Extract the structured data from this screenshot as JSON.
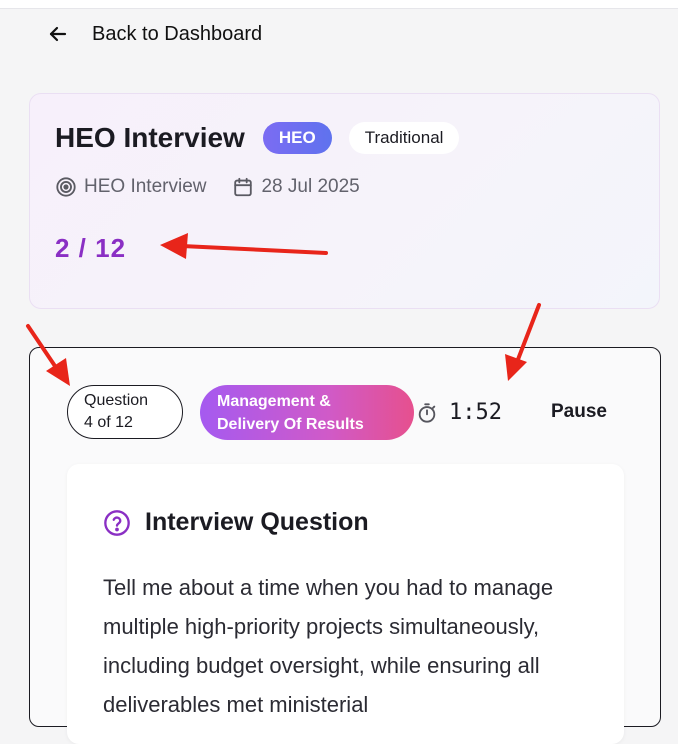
{
  "nav": {
    "back_label": "Back to Dashboard",
    "back_icon": "arrow-left-icon"
  },
  "interview": {
    "title": "HEO Interview",
    "badges": [
      "HEO",
      "Traditional"
    ],
    "meta": {
      "type_icon": "target-icon",
      "type_label": "HEO Interview",
      "date_icon": "calendar-icon",
      "date": "28 Jul 2025"
    },
    "progress_text": "2 / 12"
  },
  "question_panel": {
    "counter_line1": "Question",
    "counter_line2": "4 of 12",
    "category_line1": "Management &",
    "category_line2": "Delivery Of Results",
    "timer_icon": "stopwatch-icon",
    "timer": "1:52",
    "pause_label": "Pause",
    "heading_icon": "help-circle-icon",
    "heading": "Interview Question",
    "question_text": "Tell me about a time when you had to manage multiple high-priority projects simultaneously, including budget oversight, while ensuring all deliverables met ministerial"
  },
  "colors": {
    "accent_purple": "#8a2fc4",
    "annotation_red": "#e8251a"
  }
}
